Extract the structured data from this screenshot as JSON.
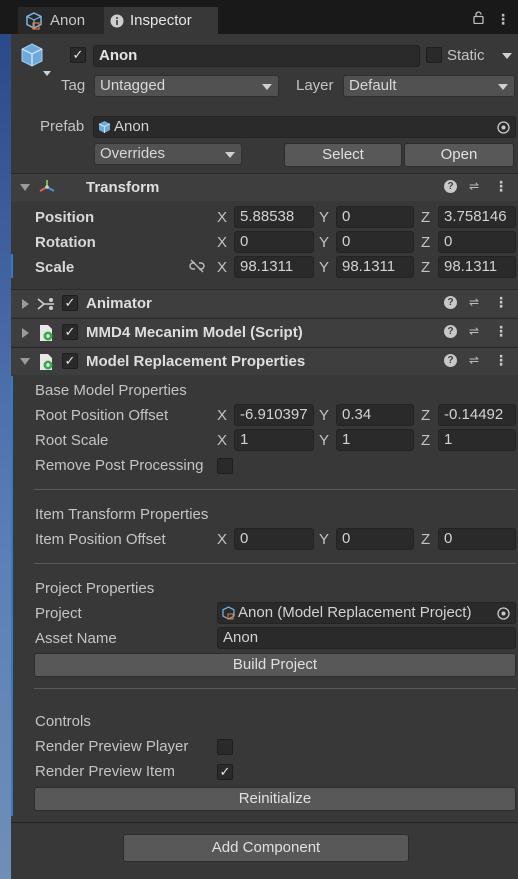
{
  "tabs": [
    {
      "label": "Anon",
      "icon": "prefab-icon",
      "active": false
    },
    {
      "label": "Inspector",
      "icon": "info-icon",
      "active": true
    }
  ],
  "tab_tools": {
    "lock": "lock-icon",
    "menu": "kebab-menu-icon"
  },
  "object": {
    "active": true,
    "name": "Anon",
    "static_label": "Static",
    "static_checked": false,
    "tag_label": "Tag",
    "tag_value": "Untagged",
    "layer_label": "Layer",
    "layer_value": "Default",
    "prefab_label": "Prefab",
    "prefab_value": "Anon",
    "overrides_label": "Overrides",
    "select_label": "Select",
    "open_label": "Open"
  },
  "transform": {
    "title": "Transform",
    "rows": [
      {
        "label": "Position",
        "x": "5.88538",
        "y": "0",
        "z": "3.758146"
      },
      {
        "label": "Rotation",
        "x": "0",
        "y": "0",
        "z": "0"
      },
      {
        "label": "Scale",
        "x": "98.1311",
        "y": "98.1311",
        "z": "98.1311"
      }
    ],
    "axis": {
      "x": "X",
      "y": "Y",
      "z": "Z"
    }
  },
  "components": {
    "animator": {
      "title": "Animator",
      "enabled": true
    },
    "mmd4": {
      "title": "MMD4 Mecanim Model (Script)",
      "enabled": true
    },
    "replacement": {
      "title": "Model Replacement Properties",
      "enabled": true
    }
  },
  "replacement": {
    "base_header": "Base Model Properties",
    "root_position_offset": {
      "label": "Root Position Offset",
      "x": "-6.910397",
      "y": "0.34",
      "z": "-0.14492"
    },
    "root_scale": {
      "label": "Root Scale",
      "x": "1",
      "y": "1",
      "z": "1"
    },
    "remove_post": {
      "label": "Remove Post Processing",
      "checked": false
    },
    "item_header": "Item Transform Properties",
    "item_position_offset": {
      "label": "Item Position Offset",
      "x": "0",
      "y": "0",
      "z": "0"
    },
    "project_header": "Project Properties",
    "project": {
      "label": "Project",
      "value": "Anon (Model Replacement Project)"
    },
    "asset_name": {
      "label": "Asset Name",
      "value": "Anon"
    },
    "build_button": "Build Project",
    "controls_header": "Controls",
    "render_preview_player": {
      "label": "Render Preview Player",
      "checked": false
    },
    "render_preview_item": {
      "label": "Render Preview Item",
      "checked": true
    },
    "reinitialize_button": "Reinitialize"
  },
  "add_component_button": "Add Component",
  "colors": {
    "background": "#383838",
    "field": "#2a2a2a",
    "button": "#585858",
    "accent_blue": "#3a79bb"
  }
}
